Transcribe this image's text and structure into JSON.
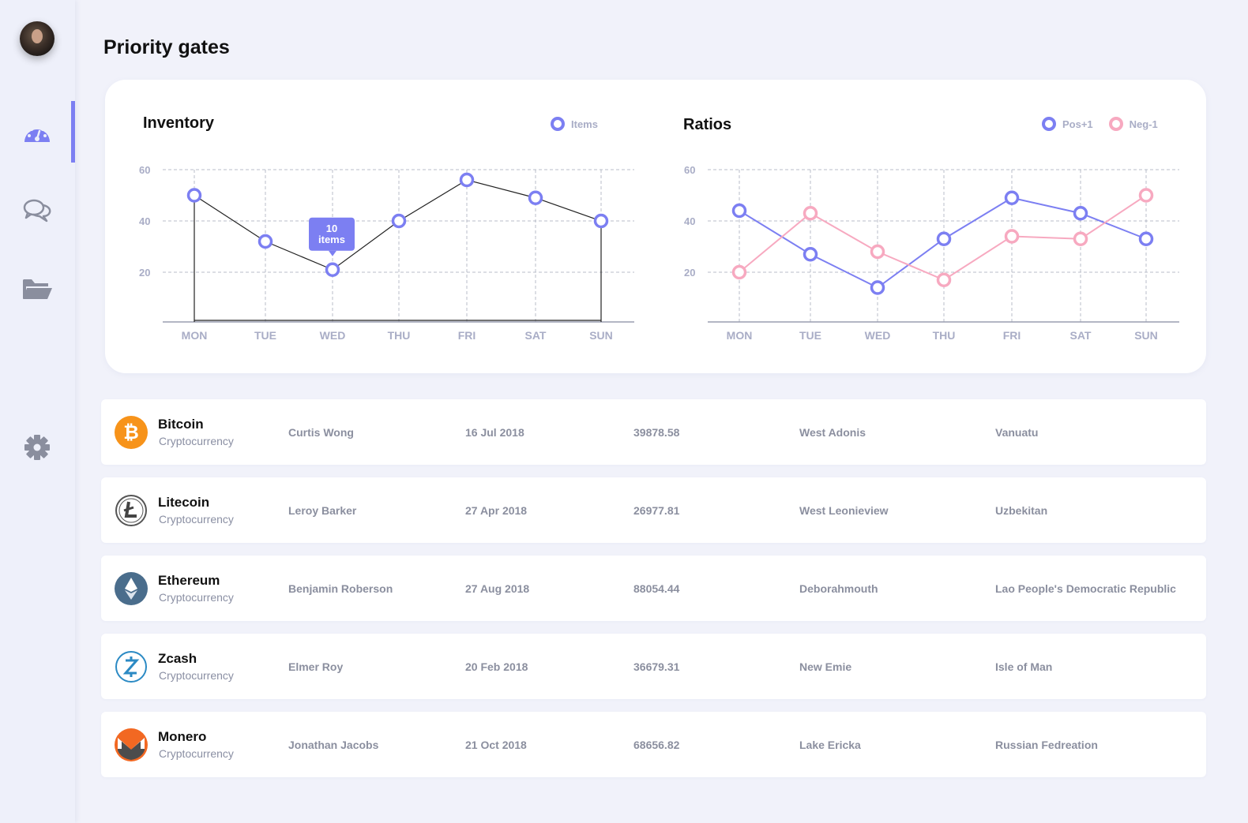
{
  "page": {
    "title": "Priority gates"
  },
  "sidebar": {
    "items": [
      {
        "name": "dashboard",
        "icon": "speedometer-icon",
        "active": true
      },
      {
        "name": "messages",
        "icon": "chat-bubbles-icon",
        "active": false
      },
      {
        "name": "files",
        "icon": "folder-open-icon",
        "active": false
      },
      {
        "name": "settings",
        "icon": "gear-icon",
        "active": false
      }
    ],
    "accent": "#7c7ff2"
  },
  "inventory_chart": {
    "title": "Inventory",
    "legend": [
      "Items"
    ],
    "tooltip": {
      "value": "10",
      "unit": "items"
    }
  },
  "ratios_chart": {
    "title": "Ratios",
    "legend": [
      "Pos+1",
      "Neg-1"
    ]
  },
  "chart_data": [
    {
      "type": "line",
      "title": "Inventory",
      "categories": [
        "MON",
        "TUE",
        "WED",
        "THU",
        "FRI",
        "SAT",
        "SUN"
      ],
      "yticks": [
        20,
        40,
        60
      ],
      "ylim": [
        0,
        60
      ],
      "series": [
        {
          "name": "Items",
          "color": "#7c7ff2",
          "values": [
            50,
            32,
            21,
            40,
            56,
            49,
            40
          ]
        }
      ],
      "grid": true,
      "legend": "top-right"
    },
    {
      "type": "line",
      "title": "Ratios",
      "categories": [
        "MON",
        "TUE",
        "WED",
        "THU",
        "FRI",
        "SAT",
        "SUN"
      ],
      "yticks": [
        20,
        40,
        60
      ],
      "ylim": [
        0,
        60
      ],
      "series": [
        {
          "name": "Pos+1",
          "color": "#7c7ff2",
          "values": [
            44,
            27,
            14,
            33,
            49,
            43,
            33
          ]
        },
        {
          "name": "Neg-1",
          "color": "#f7a9c0",
          "values": [
            20,
            43,
            28,
            17,
            34,
            33,
            50
          ]
        }
      ],
      "grid": true,
      "legend": "top-right"
    }
  ],
  "table": {
    "rows": [
      {
        "coin": "Bitcoin",
        "type": "Cryptocurrency",
        "icon": "bitcoin-icon",
        "icon_color": "#f7931a",
        "person": "Curtis Wong",
        "date": "16 Jul 2018",
        "amount": "39878.58",
        "city": "West Adonis",
        "country": "Vanuatu"
      },
      {
        "coin": "Litecoin",
        "type": "Cryptocurrency",
        "icon": "litecoin-icon",
        "icon_color": "#ffffff",
        "person": "Leroy Barker",
        "date": "27 Apr 2018",
        "amount": "26977.81",
        "city": "West Leonieview",
        "country": "Uzbekitan"
      },
      {
        "coin": "Ethereum",
        "type": "Cryptocurrency",
        "icon": "ethereum-icon",
        "icon_color": "#4a6d8c",
        "person": "Benjamin Roberson",
        "date": "27 Aug 2018",
        "amount": "88054.44",
        "city": "Deborahmouth",
        "country": "Lao People's Democratic Republic"
      },
      {
        "coin": "Zcash",
        "type": "Cryptocurrency",
        "icon": "zcash-icon",
        "icon_color": "#ffffff",
        "person": "Elmer Roy",
        "date": "20 Feb 2018",
        "amount": "36679.31",
        "city": "New Emie",
        "country": "Isle of Man"
      },
      {
        "coin": "Monero",
        "type": "Cryptocurrency",
        "icon": "monero-icon",
        "icon_color": "#f26822",
        "person": "Jonathan Jacobs",
        "date": "21 Oct 2018",
        "amount": "68656.82",
        "city": "Lake Ericka",
        "country": "Russian Fedreation"
      }
    ]
  }
}
